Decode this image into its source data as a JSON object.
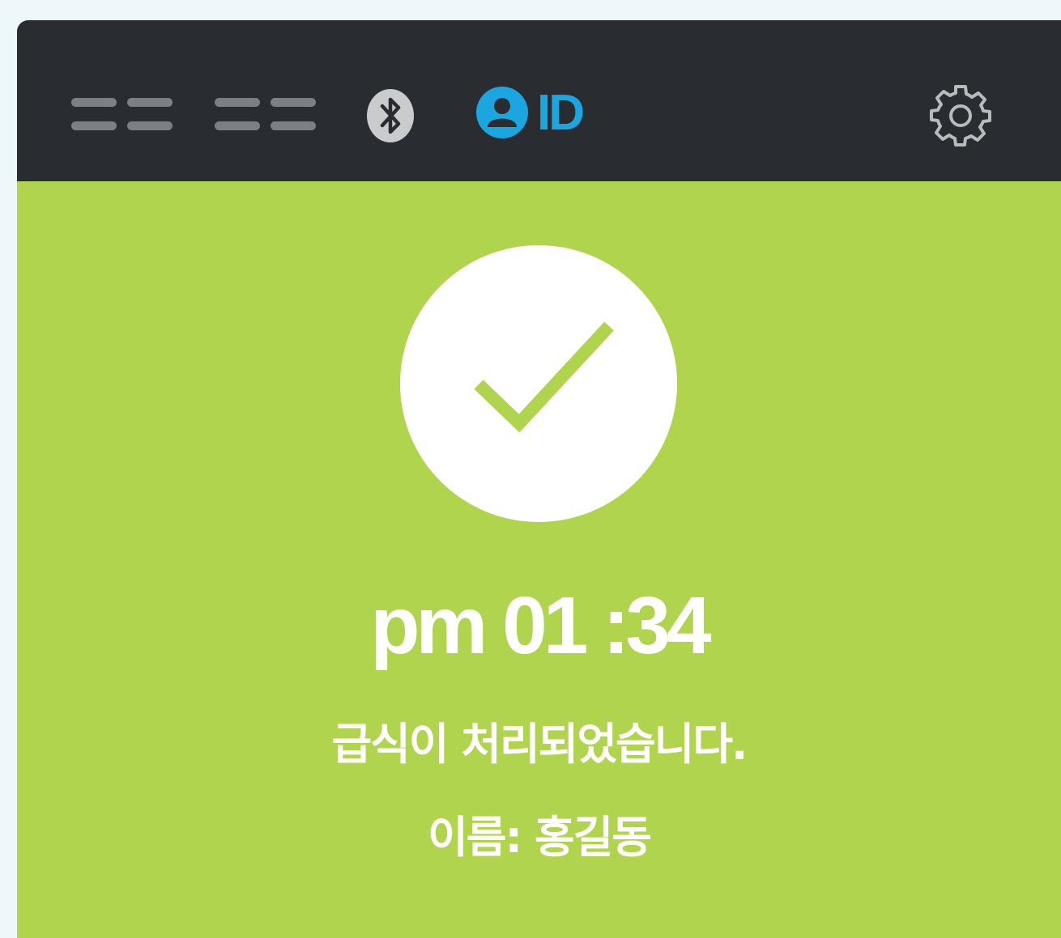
{
  "status_bar": {
    "indicators": [
      {
        "icon": "signal-dashes-icon"
      },
      {
        "icon": "signal-dashes-icon"
      },
      {
        "icon": "bluetooth-icon"
      }
    ],
    "id_icon": "user-icon",
    "id_label": "ID",
    "settings_icon": "gear-icon"
  },
  "result": {
    "icon": "check-icon",
    "time": "pm 01 :34",
    "message": "급식이 처리되었습니다.",
    "name_line": "이름: 홍길동"
  },
  "colors": {
    "background": "#eef8fb",
    "topbar": "#292d31",
    "success_green": "#b1d44e",
    "accent_blue": "#1ca6df",
    "indicator_gray": "#7c7f83"
  }
}
